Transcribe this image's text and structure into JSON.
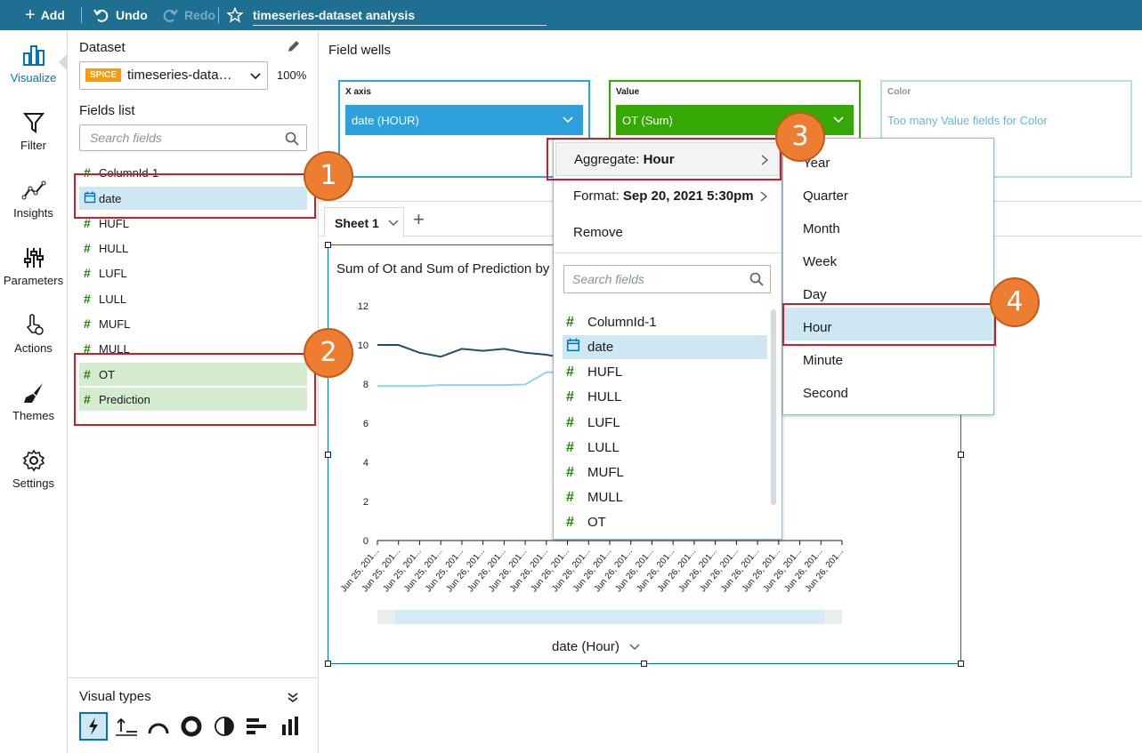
{
  "topbar": {
    "add": "Add",
    "undo": "Undo",
    "redo": "Redo",
    "title": "timeseries-dataset analysis"
  },
  "nav": [
    {
      "label": "Visualize",
      "icon": "visualize-icon"
    },
    {
      "label": "Filter",
      "icon": "filter-icon"
    },
    {
      "label": "Insights",
      "icon": "insights-icon"
    },
    {
      "label": "Parameters",
      "icon": "parameters-icon"
    },
    {
      "label": "Actions",
      "icon": "actions-icon"
    },
    {
      "label": "Themes",
      "icon": "themes-icon"
    },
    {
      "label": "Settings",
      "icon": "settings-icon"
    }
  ],
  "panel": {
    "dataset_label": "Dataset",
    "spice": "SPICE",
    "dataset_name": "timeseries-data…",
    "percent": "100%",
    "fields_label": "Fields list",
    "search_placeholder": "Search fields",
    "fields": [
      "ColumnId-1",
      "date",
      "HUFL",
      "HULL",
      "LUFL",
      "LULL",
      "MUFL",
      "MULL",
      "OT",
      "Prediction"
    ],
    "visual_types_label": "Visual types"
  },
  "wells": {
    "label": "Field wells",
    "x_axis_label": "X axis",
    "x_axis_value": "date (HOUR)",
    "value_label": "Value",
    "value_value": "OT (Sum)",
    "color_label": "Color",
    "color_value": "Too many Value fields for Color"
  },
  "sheet": {
    "tab": "Sheet 1",
    "add": "+"
  },
  "visual": {
    "title": "Sum of Ot and Sum of Prediction by",
    "xaxis_title": "date (Hour)"
  },
  "menu": {
    "aggregate_prefix": "Aggregate: ",
    "aggregate_value": "Hour",
    "format_prefix": "Format: ",
    "format_value": "Sep 20, 2021 5:30pm",
    "remove": "Remove",
    "search_placeholder": "Search fields",
    "fields": [
      "ColumnId-1",
      "date",
      "HUFL",
      "HULL",
      "LUFL",
      "LULL",
      "MUFL",
      "MULL",
      "OT"
    ]
  },
  "submenu": [
    "Year",
    "Quarter",
    "Month",
    "Week",
    "Day",
    "Hour",
    "Minute",
    "Second"
  ],
  "badges": [
    "1",
    "2",
    "3",
    "4"
  ],
  "colors": {
    "topbar": "#1f6f93",
    "xaxis_pill": "#2ea0dc",
    "value_pill": "#35a806",
    "badge": "#ed7d31",
    "highlight_box": "#c8202a",
    "series_ot": "#1d4e6e",
    "series_prediction": "#8fd3ef"
  },
  "chart_data": {
    "type": "line",
    "title": "Sum of Ot and Sum of Prediction by",
    "xlabel": "date (Hour)",
    "ylim": [
      0,
      12
    ],
    "yticks": [
      "0",
      "2",
      "4",
      "6",
      "8",
      "10",
      "12"
    ],
    "xtick_labels": [
      "Jun 25, 201...",
      "Jun 25, 201...",
      "Jun 25, 201...",
      "Jun 25, 201...",
      "Jun 25, 201...",
      "Jun 26, 201...",
      "Jun 26, 201...",
      "Jun 26, 201...",
      "Jun 26, 201...",
      "Jun 26, 201...",
      "Jun 26, 201...",
      "Jun 26, 201...",
      "Jun 26, 201...",
      "Jun 26, 201...",
      "Jun 26, 201...",
      "Jun 26, 201...",
      "Jun 26, 201...",
      "Jun 26, 201...",
      "Jun 26, 201...",
      "Jun 26, 201...",
      "Jun 26, 201...",
      "Jun 26, 201...",
      "Jun 26, 201..."
    ],
    "series": [
      {
        "values": [
          10.0,
          10.0,
          9.6,
          9.4,
          9.8,
          9.7,
          9.8,
          9.6,
          9.5,
          9.3
        ]
      },
      {
        "values": [
          7.9,
          7.9,
          7.9,
          7.95,
          7.95,
          7.95,
          7.95,
          7.98,
          8.6,
          8.6
        ]
      }
    ]
  }
}
